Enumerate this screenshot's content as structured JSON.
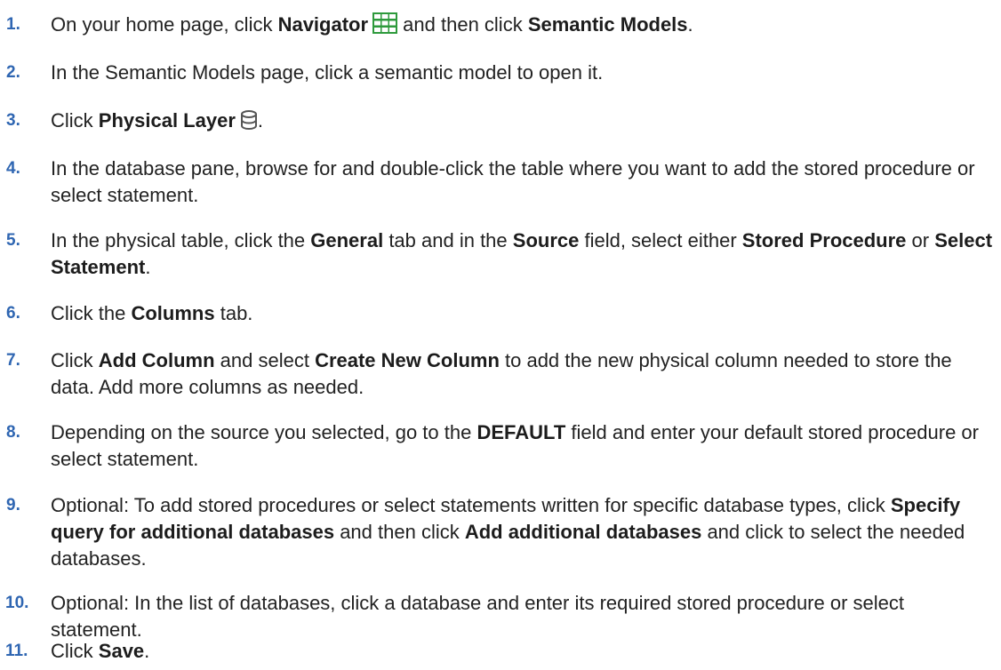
{
  "steps": [
    {
      "number": "1.",
      "parts": {
        "a": "On your home page, click ",
        "b": "Navigator",
        "icon": "grid-icon",
        "c": " and then click ",
        "d": "Semantic Models",
        "e": "."
      }
    },
    {
      "number": "2.",
      "parts": {
        "a": "In the Semantic Models page, click a semantic model to open it."
      }
    },
    {
      "number": "3.",
      "parts": {
        "a": "Click ",
        "b": "Physical Layer",
        "icon": "database-icon",
        "c": "."
      }
    },
    {
      "number": "4.",
      "parts": {
        "a": "In the database pane, browse for and double-click the table where you want to add the stored procedure or select statement."
      }
    },
    {
      "number": "5.",
      "parts": {
        "a": "In the physical table, click the ",
        "b": "General",
        "c": " tab and in the ",
        "d": "Source",
        "e": " field, select either ",
        "f": "Stored Procedure",
        "g": " or ",
        "h": "Select Statement",
        "i": "."
      }
    },
    {
      "number": "6.",
      "parts": {
        "a": "Click the ",
        "b": "Columns",
        "c": " tab."
      }
    },
    {
      "number": "7.",
      "parts": {
        "a": "Click ",
        "b": "Add Column",
        "c": " and select ",
        "d": "Create New Column",
        "e": " to add the new physical column needed to store the data. Add more columns as needed."
      }
    },
    {
      "number": "8.",
      "parts": {
        "a": "Depending on the source you selected, go to the ",
        "b": "DEFAULT",
        "c": " field and enter your default stored procedure or select statement."
      }
    },
    {
      "number": "9.",
      "parts": {
        "a": "Optional: To add stored procedures or select statements written for specific database types, click ",
        "b": "Specify query for additional databases",
        "c": " and then click ",
        "d": "Add additional databases",
        "e": " and click to select the needed databases."
      }
    },
    {
      "number": "10.",
      "parts": {
        "a": "Optional: In the list of databases, click a database and enter its required stored procedure or select statement."
      }
    },
    {
      "number": "11.",
      "parts": {
        "a": "Click ",
        "b": "Save",
        "c": "."
      }
    }
  ],
  "colors": {
    "step_number": "#2f66b2",
    "text": "#222222",
    "navigator_icon_green": "#2e9a3c",
    "database_icon_gray": "#555555"
  }
}
